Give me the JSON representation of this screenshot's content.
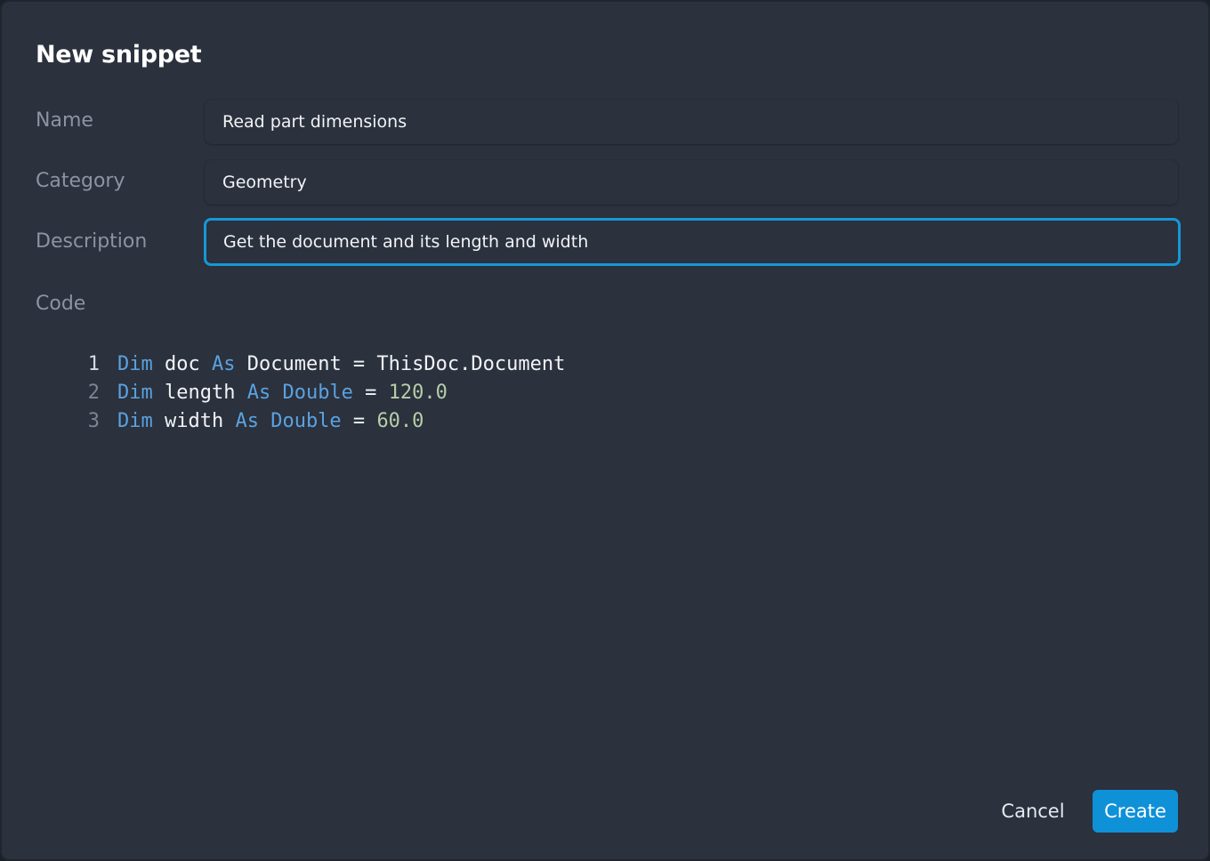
{
  "dialog": {
    "title": "New snippet"
  },
  "form": {
    "name_label": "Name",
    "name_value": "Read part dimensions",
    "category_label": "Category",
    "category_value": "Geometry",
    "description_label": "Description",
    "description_value": "Get the document and its length and width",
    "code_label": "Code"
  },
  "code": {
    "lines": [
      {
        "number": "1",
        "tokens": [
          {
            "text": "Dim",
            "kind": "keyword"
          },
          {
            "text": " doc ",
            "kind": "identifier"
          },
          {
            "text": "As",
            "kind": "keyword"
          },
          {
            "text": " Document = ThisDoc.Document",
            "kind": "identifier"
          }
        ]
      },
      {
        "number": "2",
        "tokens": [
          {
            "text": "Dim",
            "kind": "keyword"
          },
          {
            "text": " length ",
            "kind": "identifier"
          },
          {
            "text": "As Double",
            "kind": "keyword"
          },
          {
            "text": " = ",
            "kind": "identifier"
          },
          {
            "text": "120.0",
            "kind": "number"
          }
        ]
      },
      {
        "number": "3",
        "tokens": [
          {
            "text": "Dim",
            "kind": "keyword"
          },
          {
            "text": " width ",
            "kind": "identifier"
          },
          {
            "text": "As Double",
            "kind": "keyword"
          },
          {
            "text": " = ",
            "kind": "identifier"
          },
          {
            "text": "60.0",
            "kind": "number"
          }
        ]
      }
    ]
  },
  "actions": {
    "cancel_label": "Cancel",
    "create_label": "Create"
  },
  "colors": {
    "dialog_background": "#2b313d",
    "focus_border": "#1598d6",
    "primary_button": "#0f91d8",
    "keyword": "#5aa2e0",
    "number": "#b5cea8",
    "label": "#8c93a1"
  }
}
